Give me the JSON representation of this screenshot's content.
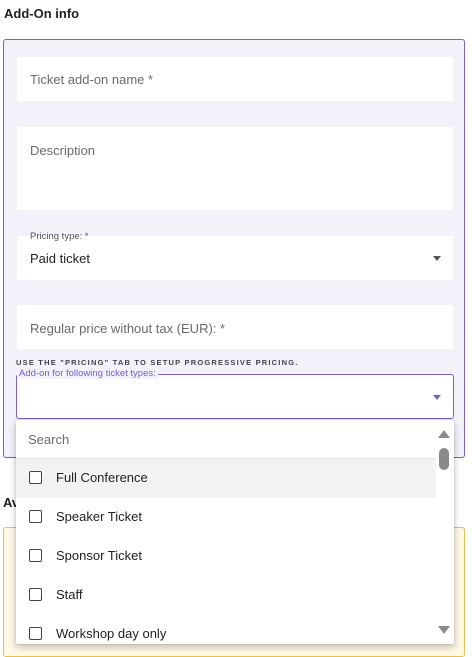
{
  "addon_info": {
    "title": "Add-On info",
    "name_placeholder": "Ticket add-on name *",
    "description_placeholder": "Description",
    "pricing_type_label": "Pricing type: *",
    "pricing_type_value": "Paid ticket",
    "price_placeholder": "Regular price without tax (EUR): *",
    "pricing_hint": "USE THE \"PRICING\" TAB TO SETUP PROGRESSIVE PRICING.",
    "ticket_types_label": "Add-on for following ticket types:"
  },
  "availability": {
    "title": "Av"
  },
  "dropdown": {
    "search_placeholder": "Search",
    "options": [
      {
        "label": "Full Conference",
        "checked": false
      },
      {
        "label": "Speaker Ticket",
        "checked": false
      },
      {
        "label": "Sponsor Ticket",
        "checked": false
      },
      {
        "label": "Staff",
        "checked": false
      },
      {
        "label": "Workshop day only",
        "checked": false
      }
    ]
  },
  "colors": {
    "accent": "#7a5ecb",
    "panel_bg": "#f3f1fa",
    "availability_border": "#e8c04a"
  }
}
